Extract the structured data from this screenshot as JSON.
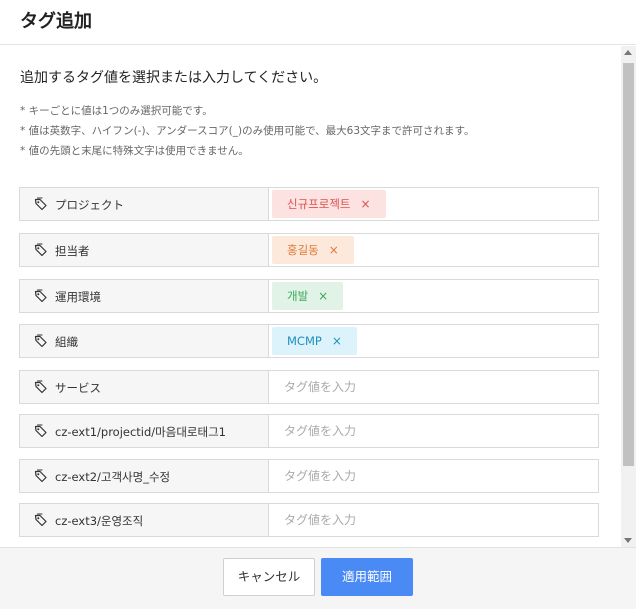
{
  "dialog": {
    "title": "タグ追加"
  },
  "intro": "追加するタグ値を選択または入力してください。",
  "notes": [
    "* キーごとに値は1つのみ選択可能です。",
    "* 値は英数字、ハイフン(-)、アンダースコア(_)のみ使用可能で、最大63文字まで許可されます。",
    "* 値の先頭と末尾に特殊文字は使用できません。"
  ],
  "tags": [
    {
      "key": "プロジェクト",
      "value": "신규프로젝트",
      "color": "#d9534f"
    },
    {
      "key": "担当者",
      "value": "홍길동",
      "color": "#e07b38"
    },
    {
      "key": "運用環境",
      "value": "개발",
      "color": "#3aa85b"
    },
    {
      "key": "組織",
      "value": "MCMP",
      "color": "#1f8fbd"
    },
    {
      "key": "サービス",
      "value": "",
      "placeholder": "タグ値を入力"
    },
    {
      "key": "cz-ext1/projectid/마음대로태그1",
      "value": "",
      "placeholder": "タグ値を入力"
    },
    {
      "key": "cz-ext2/고객사명_수정",
      "value": "",
      "placeholder": "タグ値を入力"
    },
    {
      "key": "cz-ext3/운영조직",
      "value": "",
      "placeholder": "タグ値を入力"
    }
  ],
  "chip_remove_symbol": "×",
  "icons": {
    "tag": "tag-icon",
    "remove": "close-icon"
  },
  "footer": {
    "cancel_label": "キャンセル",
    "apply_label": "適用範囲"
  },
  "colors": {
    "accent": "#4a8af4"
  }
}
